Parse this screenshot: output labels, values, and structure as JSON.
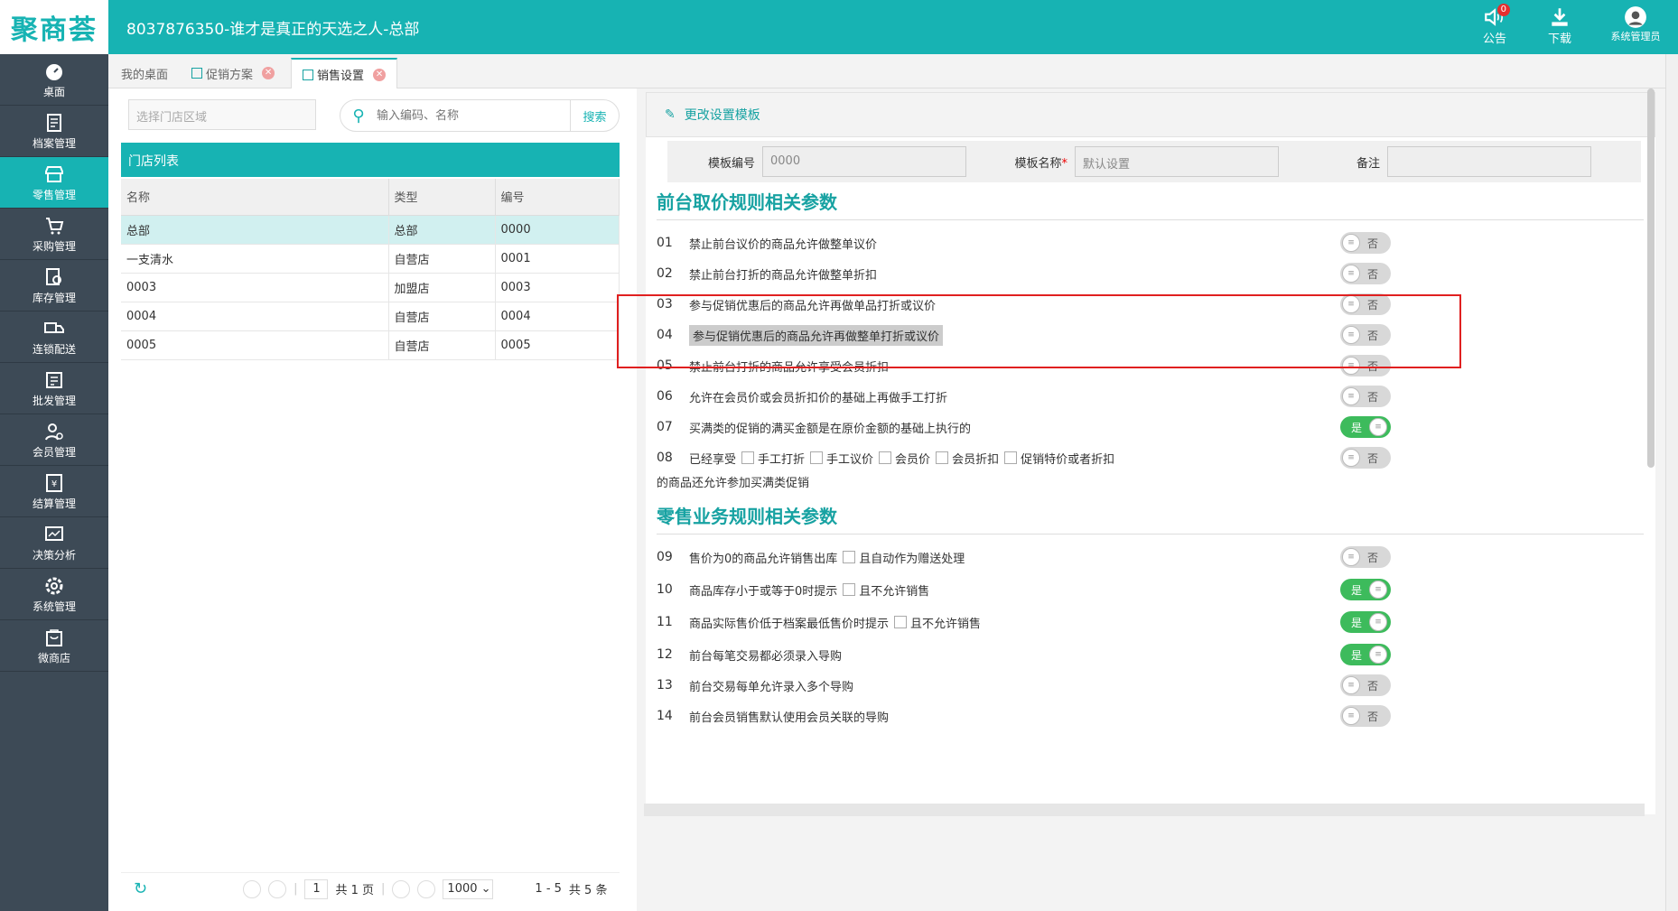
{
  "header": {
    "logo": "聚商荟",
    "title": "8037876350-谁才是真正的天选之人-总部",
    "icons": [
      {
        "name": "announce-icon",
        "label": "公告",
        "badge": "0"
      },
      {
        "name": "download-icon",
        "label": "下载"
      },
      {
        "name": "user-avatar-icon",
        "label": "系统管理员"
      }
    ]
  },
  "sidebar": {
    "items": [
      {
        "label": "桌面",
        "icon": "dashboard-icon"
      },
      {
        "label": "档案管理",
        "icon": "archive-icon"
      },
      {
        "label": "零售管理",
        "icon": "store-icon",
        "active": true
      },
      {
        "label": "采购管理",
        "icon": "purchase-icon"
      },
      {
        "label": "库存管理",
        "icon": "inventory-icon"
      },
      {
        "label": "连锁配送",
        "icon": "delivery-icon"
      },
      {
        "label": "批发管理",
        "icon": "wholesale-icon"
      },
      {
        "label": "会员管理",
        "icon": "member-icon"
      },
      {
        "label": "结算管理",
        "icon": "settlement-icon"
      },
      {
        "label": "决策分析",
        "icon": "analysis-icon"
      },
      {
        "label": "系统管理",
        "icon": "settings-icon"
      },
      {
        "label": "微商店",
        "icon": "mini-shop-icon"
      }
    ]
  },
  "tabs": [
    {
      "label": "我的桌面"
    },
    {
      "label": "促销方案",
      "closable": true
    },
    {
      "label": "销售设置",
      "closable": true,
      "active": true
    }
  ],
  "left": {
    "area_placeholder": "选择门店区域",
    "search_placeholder": "输入编码、名称",
    "search_button": "搜索",
    "list_title": "门店列表",
    "columns": [
      "名称",
      "类型",
      "编号"
    ],
    "rows": [
      [
        "总部",
        "总部",
        "0000"
      ],
      [
        "一支清水",
        "自营店",
        "0001"
      ],
      [
        "0003",
        "加盟店",
        "0003"
      ],
      [
        "0004",
        "自营店",
        "0004"
      ],
      [
        "0005",
        "自营店",
        "0005"
      ]
    ],
    "pager": {
      "page": "1",
      "total_pages": "共 1 页",
      "page_size": "1000",
      "range": "1 - 5",
      "total": "共 5 条"
    }
  },
  "right": {
    "edit_template": "更改设置模板",
    "form": {
      "code_label": "模板编号",
      "code_value": "0000",
      "name_label": "模板名称",
      "name_value": "默认设置",
      "remark_label": "备注",
      "remark_value": ""
    },
    "section1": "前台取价规则相关参数",
    "section2": "零售业务规则相关参数",
    "params": [
      {
        "num": "01",
        "text": "禁止前台议价的商品允许做整单议价",
        "state": "否"
      },
      {
        "num": "02",
        "text": "禁止前台打折的商品允许做整单折扣",
        "state": "否"
      },
      {
        "num": "03",
        "text": "参与促销优惠后的商品允许再做单品打折或议价",
        "state": "否"
      },
      {
        "num": "04",
        "text": "参与促销优惠后的商品允许再做整单打折或议价",
        "state": "否"
      },
      {
        "num": "05",
        "text": "禁止前台打折的商品允许享受会员折扣",
        "state": "否"
      },
      {
        "num": "06",
        "text": "允许在会员价或会员折扣价的基础上再做手工打折",
        "state": "否"
      },
      {
        "num": "07",
        "text": "买满类的促销的满买金额是在原价金额的基础上执行的",
        "state": "是"
      },
      {
        "num": "08",
        "text": "已经享受",
        "opts": [
          "手工打折",
          "手工议价",
          "会员价",
          "会员折扣",
          "促销特价或者折扣"
        ],
        "text2": "的商品还允许参加买满类促销",
        "state": "否"
      },
      {
        "num": "09",
        "text": "售价为0的商品允许销售出库",
        "extra": "且自动作为赠送处理",
        "state": "否"
      },
      {
        "num": "10",
        "text": "商品库存小于或等于0时提示",
        "extra": "且不允许销售",
        "state": "是"
      },
      {
        "num": "11",
        "text": "商品实际售价低于档案最低售价时提示",
        "extra": "且不允许销售",
        "state": "是"
      },
      {
        "num": "12",
        "text": "前台每笔交易都必须录入导购",
        "state": "是"
      },
      {
        "num": "13",
        "text": "前台交易每单允许录入多个导购",
        "state": "否"
      },
      {
        "num": "14",
        "text": "前台会员销售默认使用会员关联的导购",
        "state": "否"
      }
    ]
  },
  "colors": {
    "accent": "#17b3b3",
    "sidebar": "#3d4a56",
    "on": "#3dbb5c",
    "highlight_box": "#e02020"
  }
}
